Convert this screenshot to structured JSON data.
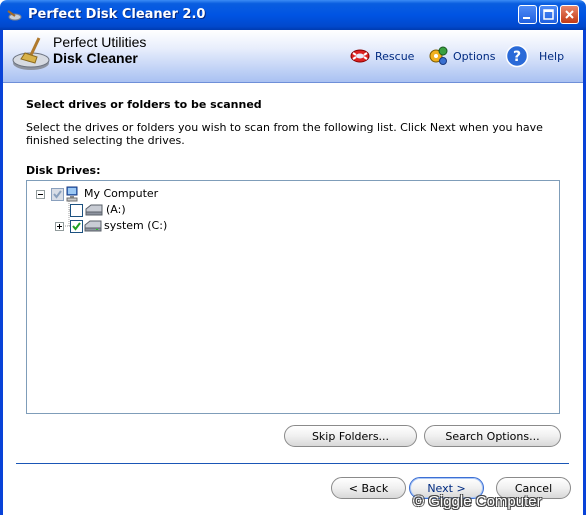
{
  "window": {
    "title": "Perfect Disk Cleaner 2.0"
  },
  "header": {
    "brand_line1": "Perfect Utilities",
    "brand_line2": "Disk Cleaner",
    "links": {
      "rescue": "Rescue",
      "options": "Options",
      "help": "Help"
    }
  },
  "content": {
    "section_title": "Select drives or folders to be scanned",
    "description": "Select the drives or folders you wish to scan from the following list. Click Next when you have finished selecting the drives.",
    "disk_drives_label": "Disk Drives:",
    "tree": {
      "root": {
        "label": "My Computer",
        "state": "partial"
      },
      "items": [
        {
          "label": "(A:)",
          "checked": false
        },
        {
          "label": "system (C:)",
          "checked": true
        }
      ]
    },
    "buttons": {
      "skip_folders": "Skip Folders...",
      "search_options": "Search Options..."
    }
  },
  "footer": {
    "back": "< Back",
    "next": "Next >",
    "cancel": "Cancel",
    "watermark": "© Giggle Computer"
  },
  "colors": {
    "titlebar": "#0054e3",
    "accent": "#1a56b6"
  }
}
